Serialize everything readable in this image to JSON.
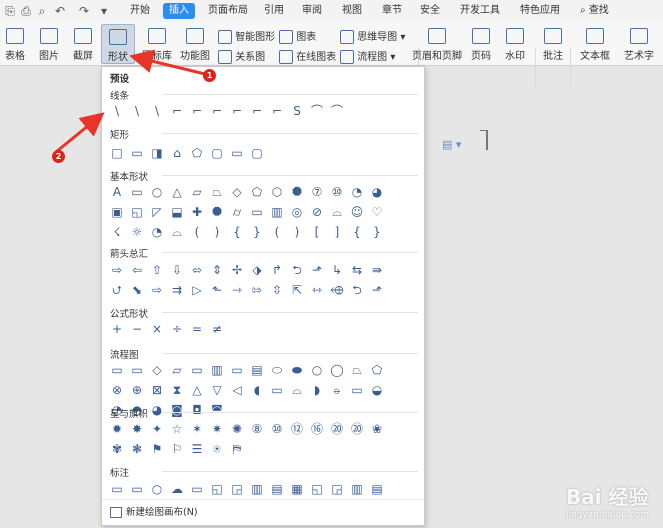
{
  "toolbar_tabs": [
    "开始",
    "插入",
    "页面布局",
    "引用",
    "审阅",
    "视图",
    "章节",
    "安全",
    "开发工具",
    "特色应用"
  ],
  "search_label": "查找",
  "ribbon": {
    "table": "表格",
    "picture": "图片",
    "screenshot": "截屏",
    "shapes": "形状",
    "iconlib": "图标库",
    "function_chart": "功能图",
    "smart_shape": "智能图形",
    "relation_chart": "关系图",
    "chart": "图表",
    "online_chart": "在线图表",
    "mindmap": "思维导图",
    "flowchart": "流程图",
    "header_footer": "页眉和页脚",
    "page_number": "页码",
    "watermark": "水印",
    "comment": "批注",
    "textbox": "文本框",
    "wordart": "艺术字"
  },
  "panel": {
    "title": "预设",
    "sections": [
      {
        "label": "线条",
        "icons": [
          "\\",
          "\\",
          "\\",
          "⌐",
          "⌐",
          "⌐",
          "⌐",
          "⌐",
          "⌐",
          "S",
          "⌒",
          "⌒"
        ]
      },
      {
        "label": "矩形",
        "icons": [
          "□",
          "▭",
          "◨",
          "⌂",
          "⬠",
          "▢",
          "▭",
          "▢"
        ]
      },
      {
        "label": "基本形状",
        "icons": [
          "A",
          "▭",
          "○",
          "△",
          "▱",
          "⏢",
          "◇",
          "⬠",
          "⬡",
          "⯃",
          "⑦",
          "⑩",
          "◔",
          "◕",
          "▣",
          "◱",
          "◸",
          "⬓",
          "✚",
          "⯃",
          "⌭",
          "▭",
          "▥",
          "◎",
          "⊘",
          "⌓",
          "☺",
          "♡",
          "☇",
          "☼",
          "◔",
          "⌓",
          "(",
          ")",
          "{",
          "}",
          "(",
          ")",
          "[",
          "]",
          "{",
          "}"
        ]
      },
      {
        "label": "箭头总汇",
        "icons": [
          "⇨",
          "⇦",
          "⇧",
          "⇩",
          "⬄",
          "⇕",
          "✢",
          "⬗",
          "↱",
          "⮌",
          "⬏",
          "↳",
          "⇆",
          "⇛",
          "⮍",
          "⬊",
          "⇨",
          "⇉",
          "▷",
          "⬑",
          "⇾",
          "⇰",
          "⇳",
          "⇱",
          "⇿",
          "⬲",
          "⮌",
          "⬏"
        ]
      },
      {
        "label": "公式形状",
        "icons": [
          "+",
          "−",
          "×",
          "÷",
          "=",
          "≠"
        ]
      },
      {
        "label": "流程图",
        "icons": [
          "▭",
          "▭",
          "◇",
          "▱",
          "▭",
          "▥",
          "▭",
          "▤",
          "⬭",
          "⬬",
          "○",
          "◯",
          "⏢",
          "⬠",
          "⊗",
          "⊕",
          "⊠",
          "⧗",
          "△",
          "▽",
          "◁",
          "◖",
          "▭",
          "⌓",
          "◗",
          "⦵",
          "▭",
          "◒",
          "◔",
          "◓",
          "◕",
          "◙",
          "◘",
          "◚"
        ]
      },
      {
        "label": "星与旗帜",
        "icons": [
          "✹",
          "✸",
          "✦",
          "☆",
          "✶",
          "✷",
          "✺",
          "⑧",
          "⑩",
          "⑫",
          "⑯",
          "⑳",
          "⑳",
          "❀",
          "✾",
          "❃",
          "⚑",
          "⚐",
          "☰",
          "⍟",
          "⛿"
        ]
      },
      {
        "label": "标注",
        "icons": [
          "▭",
          "▭",
          "○",
          "☁",
          "▭",
          "◱",
          "◲",
          "▥",
          "▤",
          "▦",
          "◱",
          "◲",
          "▥",
          "▤"
        ]
      }
    ],
    "footer_label": "新建绘图画布(N)"
  },
  "annotations": [
    "1",
    "2"
  ],
  "watermark": {
    "text": "Bai 经验",
    "sub": "jingyan.baidu.com"
  }
}
